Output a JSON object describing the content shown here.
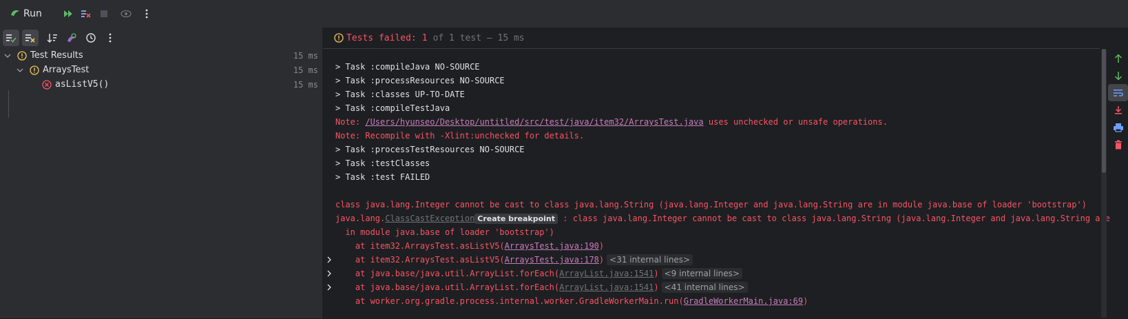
{
  "window": {
    "title": "Run"
  },
  "status": {
    "failed_label": "Tests failed:",
    "failed_count": "1",
    "rest": "of 1 test – 15 ms"
  },
  "tree": [
    {
      "label": "Test Results",
      "time": "15 ms"
    },
    {
      "label": "ArraysTest",
      "time": "15 ms"
    },
    {
      "label": "asListV5()",
      "time": "15 ms"
    }
  ],
  "console": {
    "l1": "> Task :compileJava NO-SOURCE",
    "l2": "> Task :processResources NO-SOURCE",
    "l3": "> Task :classes UP-TO-DATE",
    "l4": "> Task :compileTestJava",
    "l5_pre": "Note: ",
    "l5_link": "/Users/hyunseo/Desktop/untitled/src/test/java/item32/ArraysTest.java",
    "l5_post": " uses unchecked or unsafe operations.",
    "l6": "Note: Recompile with -Xlint:unchecked for details.",
    "l7": "> Task :processTestResources NO-SOURCE",
    "l8": "> Task :testClasses",
    "l9": "> Task :test FAILED",
    "l10": "class java.lang.Integer cannot be cast to class java.lang.String (java.lang.Integer and java.lang.String are in module java.base of loader 'bootstrap')",
    "l11_pre": "java.lang.",
    "l11_link": "ClassCastException",
    "l11_bp": "Create breakpoint",
    "l11_post": " : class java.lang.Integer cannot be cast to class java.lang.String (java.lang.Integer and java.lang.String are",
    "l12": "  in module java.base of loader 'bootstrap')",
    "l13_pre": "    at item32.ArraysTest.asListV5(",
    "l13_link": "ArraysTest.java:190",
    "l13_post": ")",
    "l14_pre": "    at item32.ArraysTest.asListV5(",
    "l14_link": "ArraysTest.java:178",
    "l14_post": ")",
    "l14_fold": "<31 internal lines>",
    "l15_pre": "    at java.base/java.util.ArrayList.forEach(",
    "l15_link": "ArrayList.java:1541",
    "l15_post": ")",
    "l15_fold": "<9 internal lines>",
    "l16_pre": "    at java.base/java.util.ArrayList.forEach(",
    "l16_link": "ArrayList.java:1541",
    "l16_post": ")",
    "l16_fold": "<41 internal lines>",
    "l17_pre": "    at worker.org.gradle.process.internal.worker.GradleWorkerMain.run(",
    "l17_link": "GradleWorkerMain.java:69",
    "l17_post": ")"
  },
  "colors": {
    "error": "#f75464",
    "link": "#c77dbb",
    "warning": "#f2c55c",
    "accent": "#3574f0"
  },
  "icons": {
    "run": "run-icon",
    "rerun_failed": "rerun-failed-icon",
    "toggle_auto": "toggle-auto-test-icon",
    "stop": "stop-icon",
    "eye": "eye-icon",
    "more": "more-vertical-icon"
  }
}
